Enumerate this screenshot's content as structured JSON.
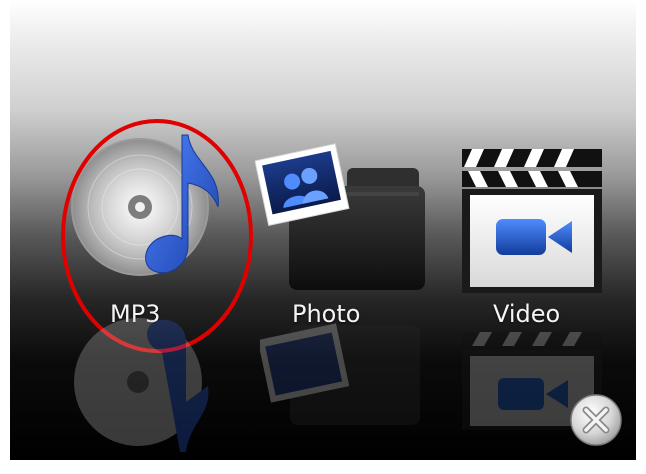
{
  "launcher": {
    "apps": [
      {
        "id": "mp3",
        "label": "MP3",
        "icon": "music-disc-note-icon",
        "selected": true
      },
      {
        "id": "photo",
        "label": "Photo",
        "icon": "photo-folder-icon",
        "selected": false
      },
      {
        "id": "video",
        "label": "Video",
        "icon": "clapperboard-camera-icon",
        "selected": false
      }
    ],
    "close_icon": "close-icon"
  },
  "colors": {
    "selection_ring": "#e00000",
    "note_blue": "#2a5ed8",
    "camera_blue": "#1f5fd0",
    "label_text": "#f4f4f4"
  }
}
